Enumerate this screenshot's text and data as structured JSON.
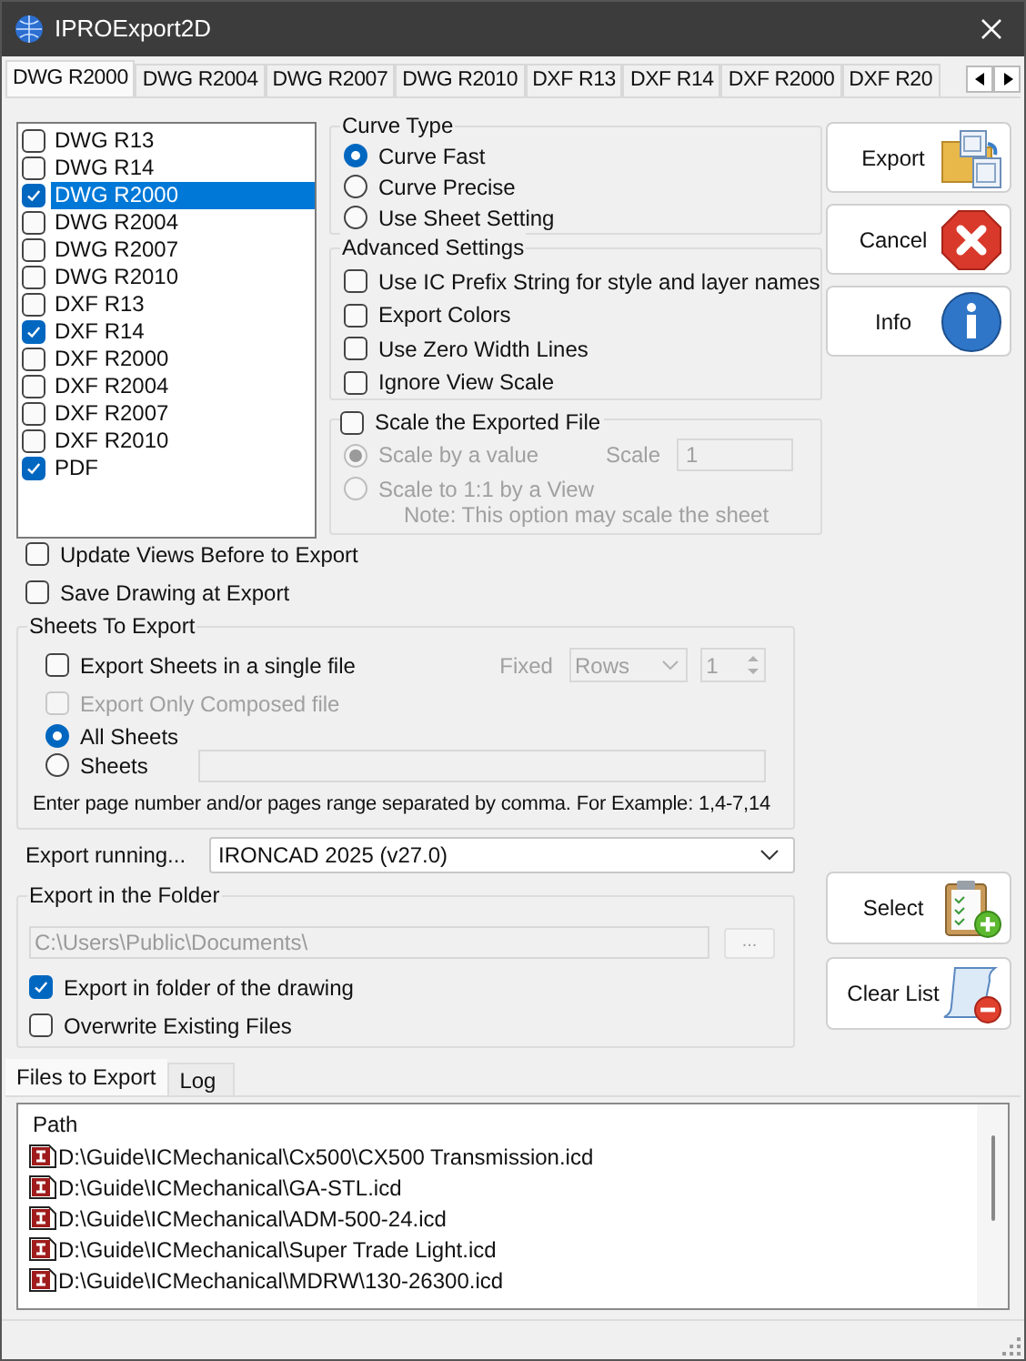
{
  "window": {
    "title": "IPROExport2D"
  },
  "format_tabs": [
    {
      "label": "DWG R2000",
      "selected": true
    },
    {
      "label": "DWG R2004",
      "selected": false
    },
    {
      "label": "DWG R2007",
      "selected": false
    },
    {
      "label": "DWG R2010",
      "selected": false
    },
    {
      "label": "DXF R13",
      "selected": false
    },
    {
      "label": "DXF R14",
      "selected": false
    },
    {
      "label": "DXF R2000",
      "selected": false
    },
    {
      "label": "DXF R20",
      "selected": false
    }
  ],
  "formats": [
    {
      "label": "DWG R13",
      "checked": false,
      "selected": false
    },
    {
      "label": "DWG R14",
      "checked": false,
      "selected": false
    },
    {
      "label": "DWG R2000",
      "checked": true,
      "selected": true
    },
    {
      "label": "DWG R2004",
      "checked": false,
      "selected": false
    },
    {
      "label": "DWG R2007",
      "checked": false,
      "selected": false
    },
    {
      "label": "DWG R2010",
      "checked": false,
      "selected": false
    },
    {
      "label": "DXF R13",
      "checked": false,
      "selected": false
    },
    {
      "label": "DXF R14",
      "checked": true,
      "selected": false
    },
    {
      "label": "DXF R2000",
      "checked": false,
      "selected": false
    },
    {
      "label": "DXF R2004",
      "checked": false,
      "selected": false
    },
    {
      "label": "DXF R2007",
      "checked": false,
      "selected": false
    },
    {
      "label": "DXF R2010",
      "checked": false,
      "selected": false
    },
    {
      "label": "PDF",
      "checked": true,
      "selected": false
    }
  ],
  "curve_type": {
    "title": "Curve Type",
    "options": [
      {
        "label": "Curve Fast",
        "selected": true
      },
      {
        "label": "Curve Precise",
        "selected": false
      },
      {
        "label": "Use Sheet Setting",
        "selected": false
      }
    ]
  },
  "advanced": {
    "title": "Advanced Settings",
    "options": [
      {
        "label": "Use IC Prefix String for style and layer names",
        "checked": false
      },
      {
        "label": "Export Colors",
        "checked": false
      },
      {
        "label": "Use Zero Width Lines",
        "checked": false
      },
      {
        "label": "Ignore View Scale",
        "checked": false
      }
    ]
  },
  "scale": {
    "label": "Scale the Exported File",
    "checked": false,
    "options": [
      {
        "label": "Scale by a value",
        "selected": true,
        "disabled": true
      },
      {
        "label": "Scale to 1:1 by a View",
        "selected": false,
        "disabled": true
      }
    ],
    "scale_label": "Scale",
    "scale_value": "1",
    "note": "Note: This option may scale the sheet"
  },
  "general_options": [
    {
      "label": "Update Views Before to Export",
      "checked": false
    },
    {
      "label": "Save Drawing at Export",
      "checked": false
    }
  ],
  "sheets": {
    "title": "Sheets To Export",
    "single_file": {
      "label": "Export Sheets in a single file",
      "checked": false
    },
    "fixed_label": "Fixed",
    "fixed_value": "Rows",
    "fixed_count": "1",
    "composed": {
      "label": "Export Only Composed file",
      "checked": false,
      "disabled": true
    },
    "radios": [
      {
        "label": "All Sheets",
        "selected": true
      },
      {
        "label": "Sheets",
        "selected": false
      }
    ],
    "hint": "Enter page number and/or pages range separated by comma. For Example: 1,4-7,14"
  },
  "export_running": {
    "label": "Export running...",
    "value": "IRONCAD 2025 (v27.0)"
  },
  "folder": {
    "title": "Export in the Folder",
    "path": "C:\\Users\\Public\\Documents\\",
    "browse": "...",
    "options": [
      {
        "label": "Export in folder of the drawing",
        "checked": true
      },
      {
        "label": "Overwrite Existing Files",
        "checked": false
      }
    ]
  },
  "buttons": [
    {
      "label": "Export",
      "kind": "export"
    },
    {
      "label": "Cancel",
      "kind": "cancel"
    },
    {
      "label": "Info",
      "kind": "info"
    }
  ],
  "list_buttons": [
    {
      "label": "Select",
      "kind": "select"
    },
    {
      "label": "Clear List",
      "kind": "clear"
    }
  ],
  "bottom_tabs": [
    {
      "label": "Files to Export",
      "selected": true
    },
    {
      "label": "Log",
      "selected": false
    }
  ],
  "files": {
    "column": "Path",
    "rows": [
      "D:\\Guide\\ICMechanical\\Cx500\\CX500 Transmission.icd",
      "D:\\Guide\\ICMechanical\\GA-STL.icd",
      "D:\\Guide\\ICMechanical\\ADM-500-24.icd",
      "D:\\Guide\\ICMechanical\\Super Trade Light.icd",
      "D:\\Guide\\ICMechanical\\MDRW\\130-26300.icd"
    ]
  }
}
